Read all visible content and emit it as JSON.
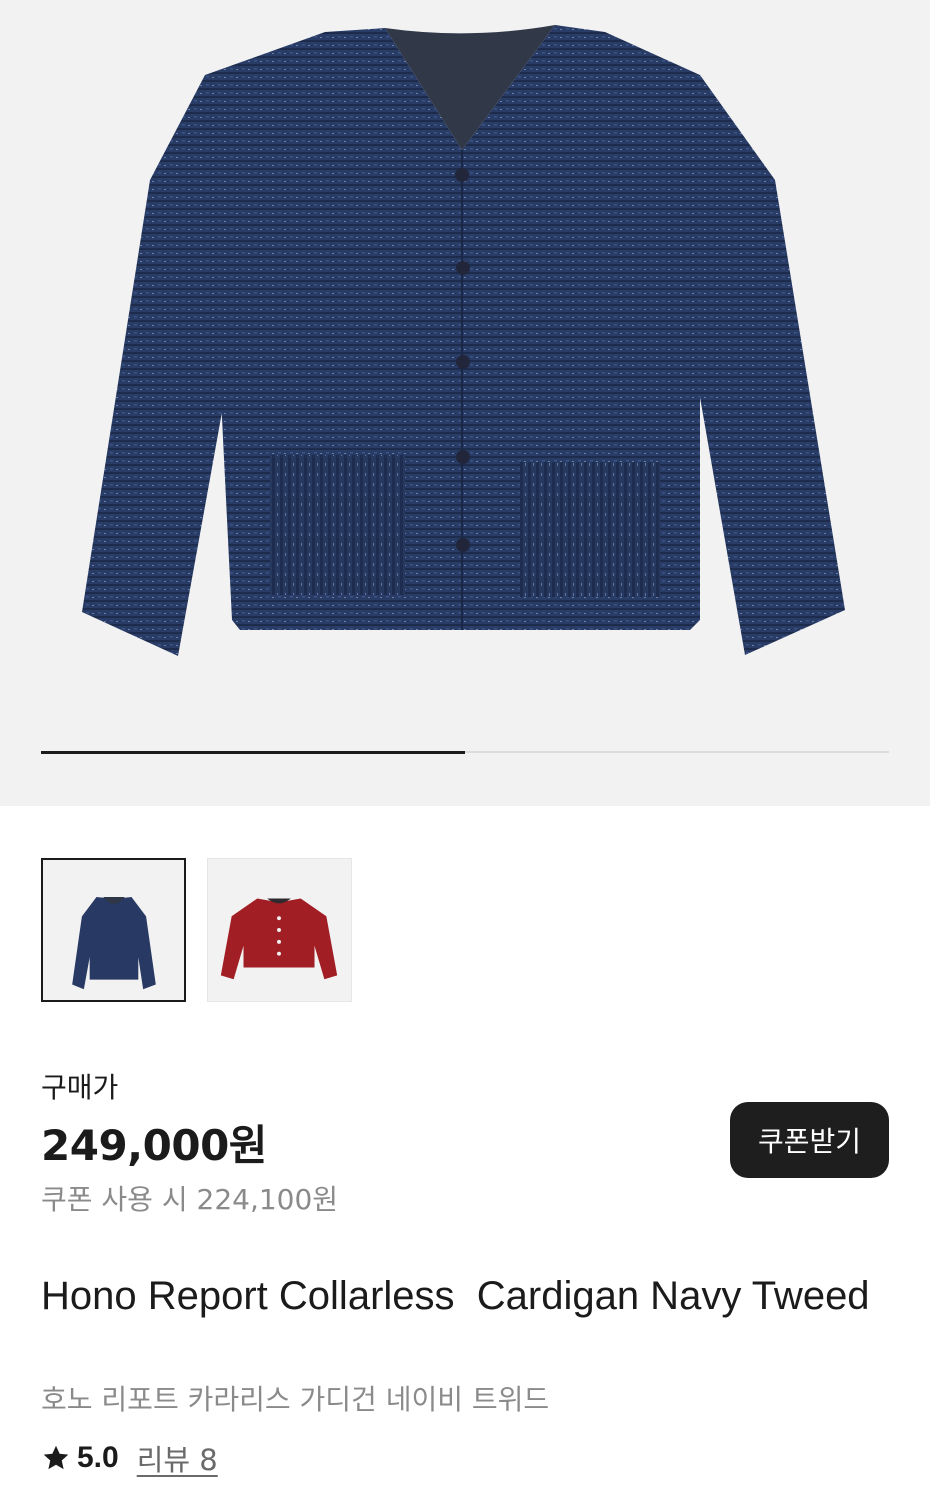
{
  "product": {
    "price_label": "구매가",
    "price": "249,000원",
    "coupon_price_text": "쿠폰 사용 시 224,100원",
    "coupon_button_label": "쿠폰받기",
    "title": "Hono Report Collarless  Cardigan Navy Tweed",
    "subtitle": "호노 리포트 카라리스 가디건 네이비 트위드",
    "rating": "5.0",
    "review_link": "리뷰 8"
  },
  "gallery": {
    "carousel_progress": 0.5,
    "variants": [
      {
        "color_name": "navy",
        "color": "#283a63",
        "selected": true
      },
      {
        "color_name": "red",
        "color": "#a11f24",
        "selected": false
      }
    ]
  },
  "colors": {
    "text": "#1b1b1b",
    "muted": "#8a8a8a",
    "button_bg": "#1e1e1e",
    "hero_bg": "#f2f2f2"
  }
}
